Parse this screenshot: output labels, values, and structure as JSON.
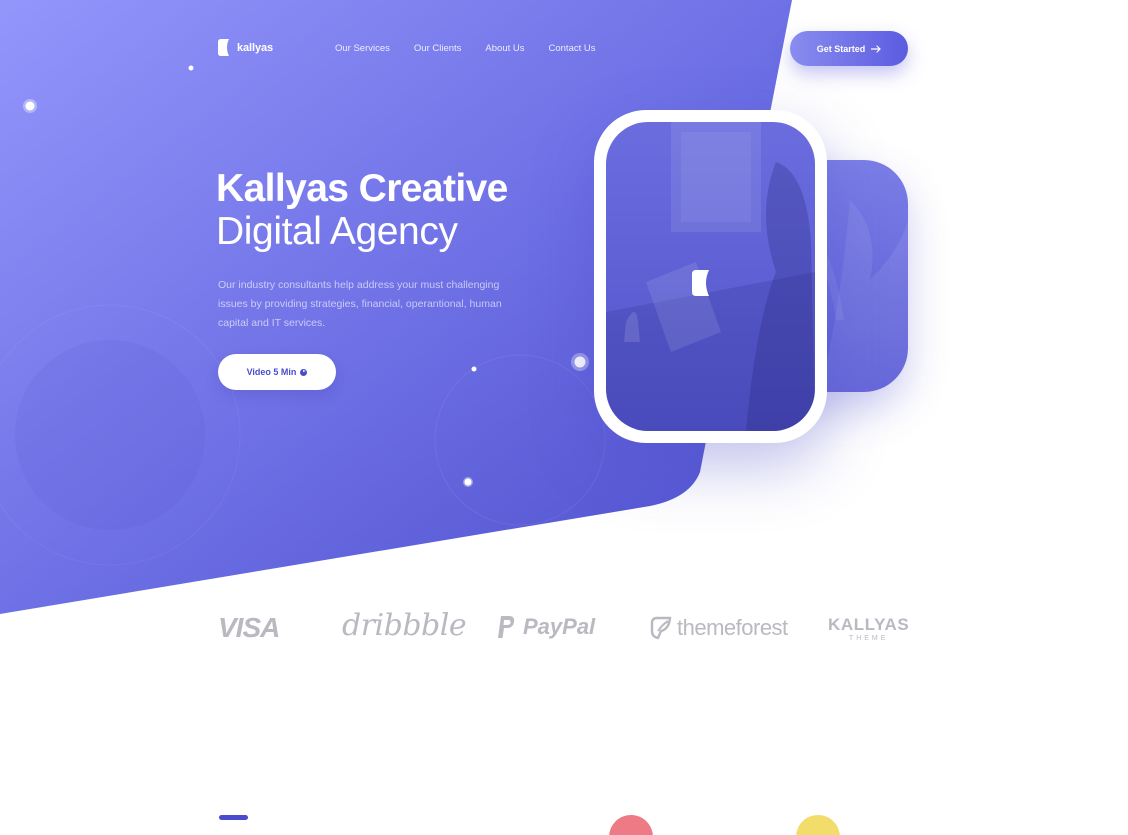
{
  "brand": {
    "name": "kallyas",
    "accent": "#5b5ce0",
    "hero_gradient": [
      "#9396fb",
      "#5556d3"
    ]
  },
  "nav": {
    "items": [
      "Our Services",
      "Our Clients",
      "About Us",
      "Contact Us"
    ],
    "cta_label": "Get Started"
  },
  "hero": {
    "headline": "Kallyas Creative",
    "subheadline": "Digital Agency",
    "description": "Our industry consultants help address your must challenging issues by providing strategies, financial, operantional, human capital and IT services.",
    "video_button_label": "Video 5 Min"
  },
  "partners": {
    "visa": "VISA",
    "dribbble": "dribbble",
    "paypal": "PayPal",
    "themeforest": "themeforest",
    "kallyas": "KALLYAS",
    "kallyas_sub": "THEME"
  },
  "icons": {
    "logo": "kallyas-k-logo-icon",
    "cta": "arrow-right-icon",
    "video": "play-icon"
  },
  "colors": {
    "section_dash": "#4a4ccb",
    "feature_circle_1": "#ee7a86",
    "feature_circle_2": "#f2dc6a"
  }
}
